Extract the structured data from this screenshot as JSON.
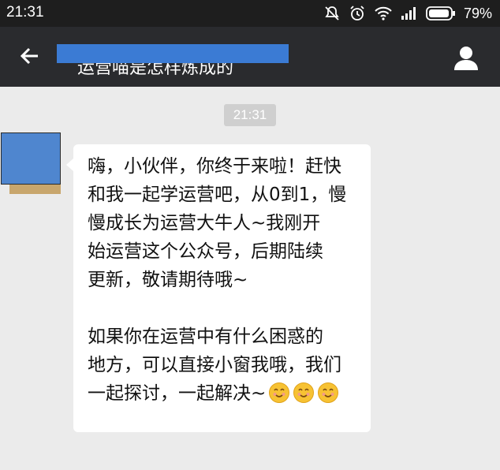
{
  "status_bar": {
    "time": "21:31",
    "battery_percent": "79%",
    "icons": [
      "do-not-disturb-icon",
      "alarm-icon",
      "wifi-icon",
      "signal-icon",
      "battery-icon"
    ]
  },
  "app_bar": {
    "title": "运营喵是怎样炼成的",
    "back_icon": "back-arrow-icon",
    "profile_icon": "profile-icon"
  },
  "chat": {
    "timestamp": "21:31",
    "message": {
      "lines_p1": [
        "嗨，小伙伴，你终于来啦！赶快",
        "和我一起学运营吧，从0到1，慢",
        "慢成长为运营大牛人~我刚开",
        "始运营这个公众号，后期陆续",
        "更新，敬请期待哦~"
      ],
      "lines_p2": [
        "如果你在运营中有什么困惑的",
        "地方，可以直接小窗我哦，我们",
        "一起探讨，一起解决~"
      ],
      "emoji_count": 3,
      "emoji_icon": "smiley-emoji-icon"
    }
  },
  "colors": {
    "status_bar": "#1e1e1e",
    "app_bar": "#2a2b2e",
    "chat_background": "#ebebeb",
    "redaction_blue": "#3b7bd4",
    "emoji_yellow": "#f7c233"
  }
}
